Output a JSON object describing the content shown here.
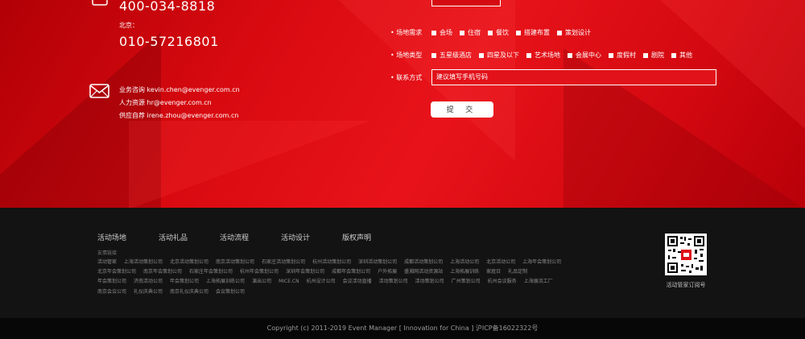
{
  "contact": {
    "phone_main": "400-034-8818",
    "beijing_label": "北京：",
    "phone_beijing": "010-57216801",
    "emails": [
      {
        "label": "业务咨询",
        "value": "kevin.chen@evenger.com.cn"
      },
      {
        "label": "人力资源",
        "value": "hr@evenger.com.cn"
      },
      {
        "label": "供应自荐",
        "value": "irene.zhou@evenger.com.cn"
      }
    ]
  },
  "form": {
    "venue_need_label": "场地需求",
    "venue_need_options": [
      "会场",
      "住宿",
      "餐饮",
      "搭建布置",
      "策划设计"
    ],
    "venue_type_label": "场地类型",
    "venue_type_options": [
      "五星级酒店",
      "四星及以下",
      "艺术场地",
      "会展中心",
      "度假村",
      "剧院",
      "其他"
    ],
    "contact_label": "联系方式",
    "contact_placeholder": "建议填写手机号码",
    "submit_label": "提 交"
  },
  "footer": {
    "nav": [
      "活动场地",
      "活动礼品",
      "活动流程",
      "活动设计",
      "版权声明"
    ],
    "friend_links_title": "友情链接",
    "links": [
      [
        "活动管家",
        "上海活动策划公司",
        "北京活动策划公司",
        "南京活动策划公司",
        "石家庄活动策划公司",
        "杭州活动策划公司",
        "深圳活动策划公司",
        "成都活动策划公司",
        "上海活动公司",
        "北京活动公司",
        "上海年会策划公司"
      ],
      [
        "北京年会策划公司",
        "南京年会策划公司",
        "石家庄年会策划公司",
        "杭州年会策划公司",
        "深圳年会策划公司",
        "成都年会策划公司",
        "户外拓展",
        "盛湘网活动资源站",
        "上海拓展训练",
        "家庭日",
        "礼品定制"
      ],
      [
        "年会策划公司",
        "济南活动公司",
        "年会策划公司",
        "上海拓展训练公司",
        "演出公司",
        "MICE.CN",
        "杭州设计公司",
        "会议活动直播",
        "活动策划公司",
        "活动策划公司",
        "广州策划公司",
        "杭州会议服务",
        "上海展流工厂"
      ],
      [
        "南京会议公司",
        "礼仪庆典公司",
        "南京礼仪庆典公司",
        "会议策划公司"
      ]
    ],
    "qr_caption": "活动管家订阅号",
    "copyright": "Copyright (c) 2011-2019 Event Manager [ Innovation for China ] 沪ICP备16022322号"
  },
  "colors": {
    "brand_red": "#e0101a",
    "footer_dark": "#131313",
    "copyright_bar": "#070707"
  }
}
